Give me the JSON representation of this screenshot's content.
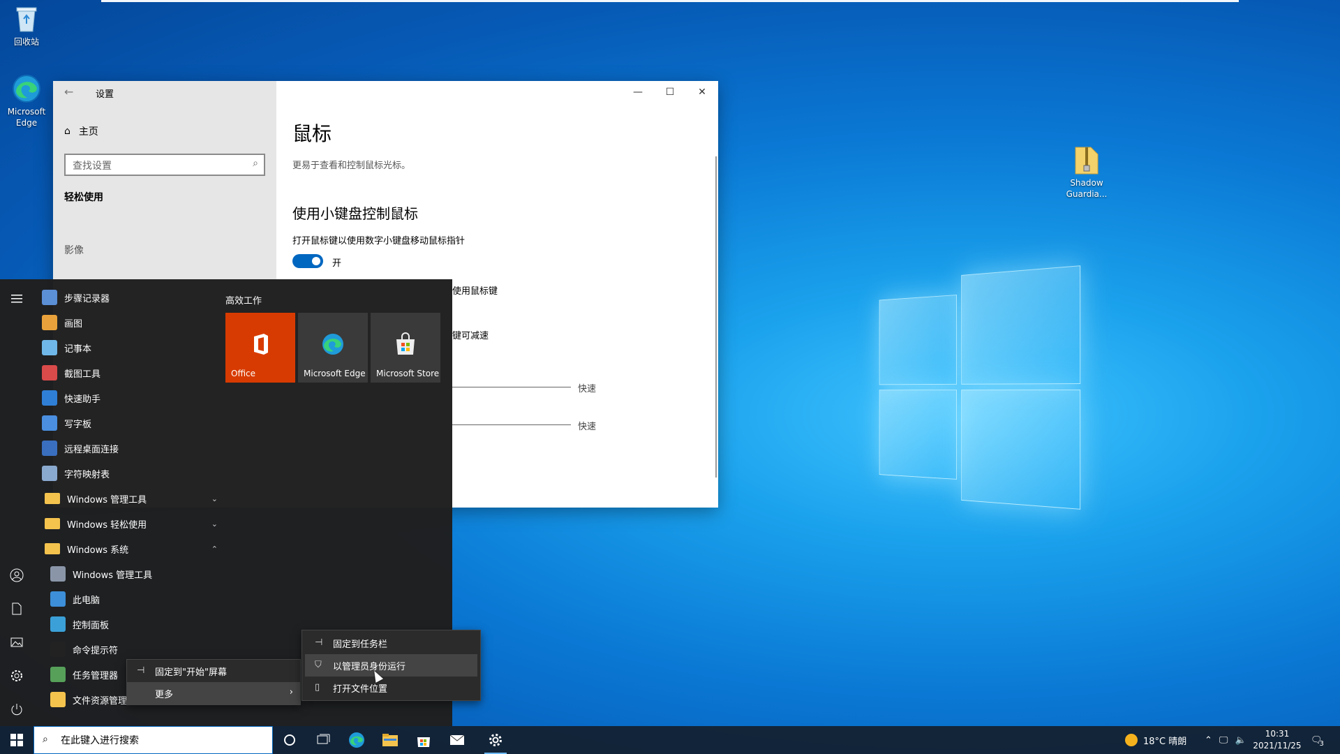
{
  "desktop": {
    "icons": [
      {
        "name": "recycle-bin",
        "label": "回收站"
      },
      {
        "name": "edge",
        "label": "Microsoft Edge"
      },
      {
        "name": "shadow",
        "label": "Shadow Guardia..."
      }
    ]
  },
  "settings": {
    "title": "设置",
    "home": "主页",
    "search_placeholder": "查找设置",
    "category": "轻松使用",
    "section": "影像",
    "heading": "鼠标",
    "description": "更易于查看和控制鼠标光标。",
    "subheading": "使用小键盘控制鼠标",
    "option_label": "打开鼠标键以使用数字小键盘移动鼠标指针",
    "toggle_state": "开",
    "partial_text_1": "使用鼠标键",
    "partial_text_2": "键可减速",
    "slider_1_max": "快速",
    "slider_2_max": "快速",
    "controls": {
      "minimize": "—",
      "maximize": "☐",
      "close": "✕"
    }
  },
  "start_menu": {
    "apps": [
      {
        "label": "步骤记录器",
        "kind": "app",
        "color": "#5b8fd6"
      },
      {
        "label": "画图",
        "kind": "app",
        "color": "#e9a23b"
      },
      {
        "label": "记事本",
        "kind": "app",
        "color": "#6fb7e8"
      },
      {
        "label": "截图工具",
        "kind": "app",
        "color": "#d94a4a"
      },
      {
        "label": "快速助手",
        "kind": "app",
        "color": "#2f7fd6"
      },
      {
        "label": "写字板",
        "kind": "app",
        "color": "#4a8fe0"
      },
      {
        "label": "远程桌面连接",
        "kind": "app",
        "color": "#3a6fc0"
      },
      {
        "label": "字符映射表",
        "kind": "app",
        "color": "#8aa9cf"
      },
      {
        "label": "Windows 管理工具",
        "kind": "folder",
        "chevron": "⌄"
      },
      {
        "label": "Windows 轻松使用",
        "kind": "folder",
        "chevron": "⌄"
      },
      {
        "label": "Windows 系统",
        "kind": "folder",
        "chevron": "⌃"
      },
      {
        "label": "Windows 管理工具",
        "kind": "sub",
        "color": "#8a96a8"
      },
      {
        "label": "此电脑",
        "kind": "sub",
        "color": "#3c8fd8"
      },
      {
        "label": "控制面板",
        "kind": "sub",
        "color": "#3ba0d8"
      },
      {
        "label": "命令提示符",
        "kind": "sub",
        "color": "#222222"
      },
      {
        "label": "任务管理器",
        "kind": "sub",
        "color": "#56a05a"
      },
      {
        "label": "文件资源管理器",
        "kind": "sub",
        "color": "#f4c34e"
      }
    ],
    "tiles_header": "高效工作",
    "tiles": [
      {
        "label": "Office",
        "bg": "#d83b01"
      },
      {
        "label": "Microsoft Edge",
        "bg": "#3a3a3a"
      },
      {
        "label": "Microsoft Store",
        "bg": "#3a3a3a"
      }
    ]
  },
  "context_menu": {
    "pin_start": "固定到\"开始\"屏幕",
    "more": "更多",
    "pin_taskbar": "固定到任务栏",
    "run_admin": "以管理员身份运行",
    "open_location": "打开文件位置"
  },
  "taskbar": {
    "search_placeholder": "在此键入进行搜索",
    "weather": "18°C 晴朗",
    "time": "10:31",
    "date": "2021/11/25",
    "notifications": "3"
  },
  "colors": {
    "accent": "#0067c0",
    "office": "#d83b01"
  }
}
